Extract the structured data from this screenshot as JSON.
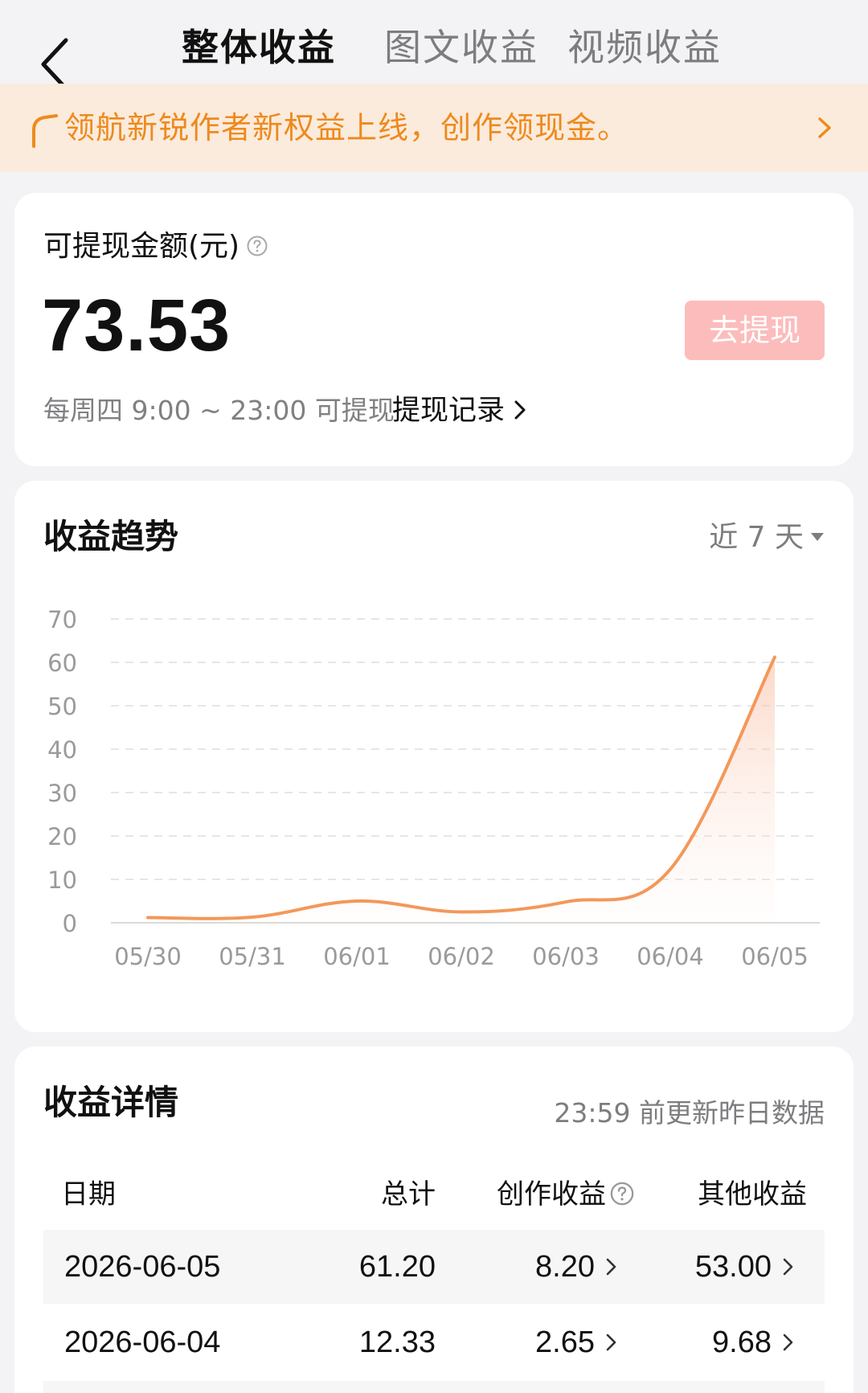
{
  "header": {
    "tabs": [
      {
        "label": "整体收益",
        "active": true
      },
      {
        "label": "图文收益",
        "active": false
      },
      {
        "label": "视频收益",
        "active": false
      }
    ]
  },
  "banner": {
    "text": "领航新锐作者新权益上线，创作领现金。",
    "color": "#ee8a1c",
    "background": "#fbebdd"
  },
  "balance": {
    "label": "可提现金额(元)",
    "amount": "73.53",
    "withdraw_button": "去提现",
    "time_note": "每周四 9:00 ~ 23:00 可提现",
    "record_link": "提现记录"
  },
  "trend": {
    "title": "收益趋势",
    "range": "近 7 天"
  },
  "chart_data": {
    "type": "area",
    "title": "",
    "xlabel": "",
    "ylabel": "",
    "categories": [
      "05/30",
      "05/31",
      "06/01",
      "06/02",
      "06/03",
      "06/04",
      "06/05"
    ],
    "series": [
      {
        "values": [
          1.2,
          1.3,
          5.0,
          2.5,
          4.8,
          12.33,
          61.2
        ],
        "color": "#f3985a"
      }
    ],
    "yticks": [
      0,
      10,
      20,
      30,
      40,
      50,
      60,
      70
    ],
    "ylim": [
      0,
      70
    ],
    "grid": true,
    "legend": "none"
  },
  "detail": {
    "title": "收益详情",
    "update_note": "23:59 前更新昨日数据",
    "columns": [
      "日期",
      "总计",
      "创作收益",
      "其他收益"
    ],
    "rows": [
      {
        "date": "2026-06-05",
        "total": "61.20",
        "creation": "8.20",
        "other": "53.00"
      },
      {
        "date": "2026-06-04",
        "total": "12.33",
        "creation": "2.65",
        "other": "9.68"
      }
    ]
  },
  "icons": {
    "back": "back-arrow-icon",
    "help": "question-circle-icon",
    "chevron": "chevron-right-icon",
    "caret": "caret-down-icon"
  }
}
